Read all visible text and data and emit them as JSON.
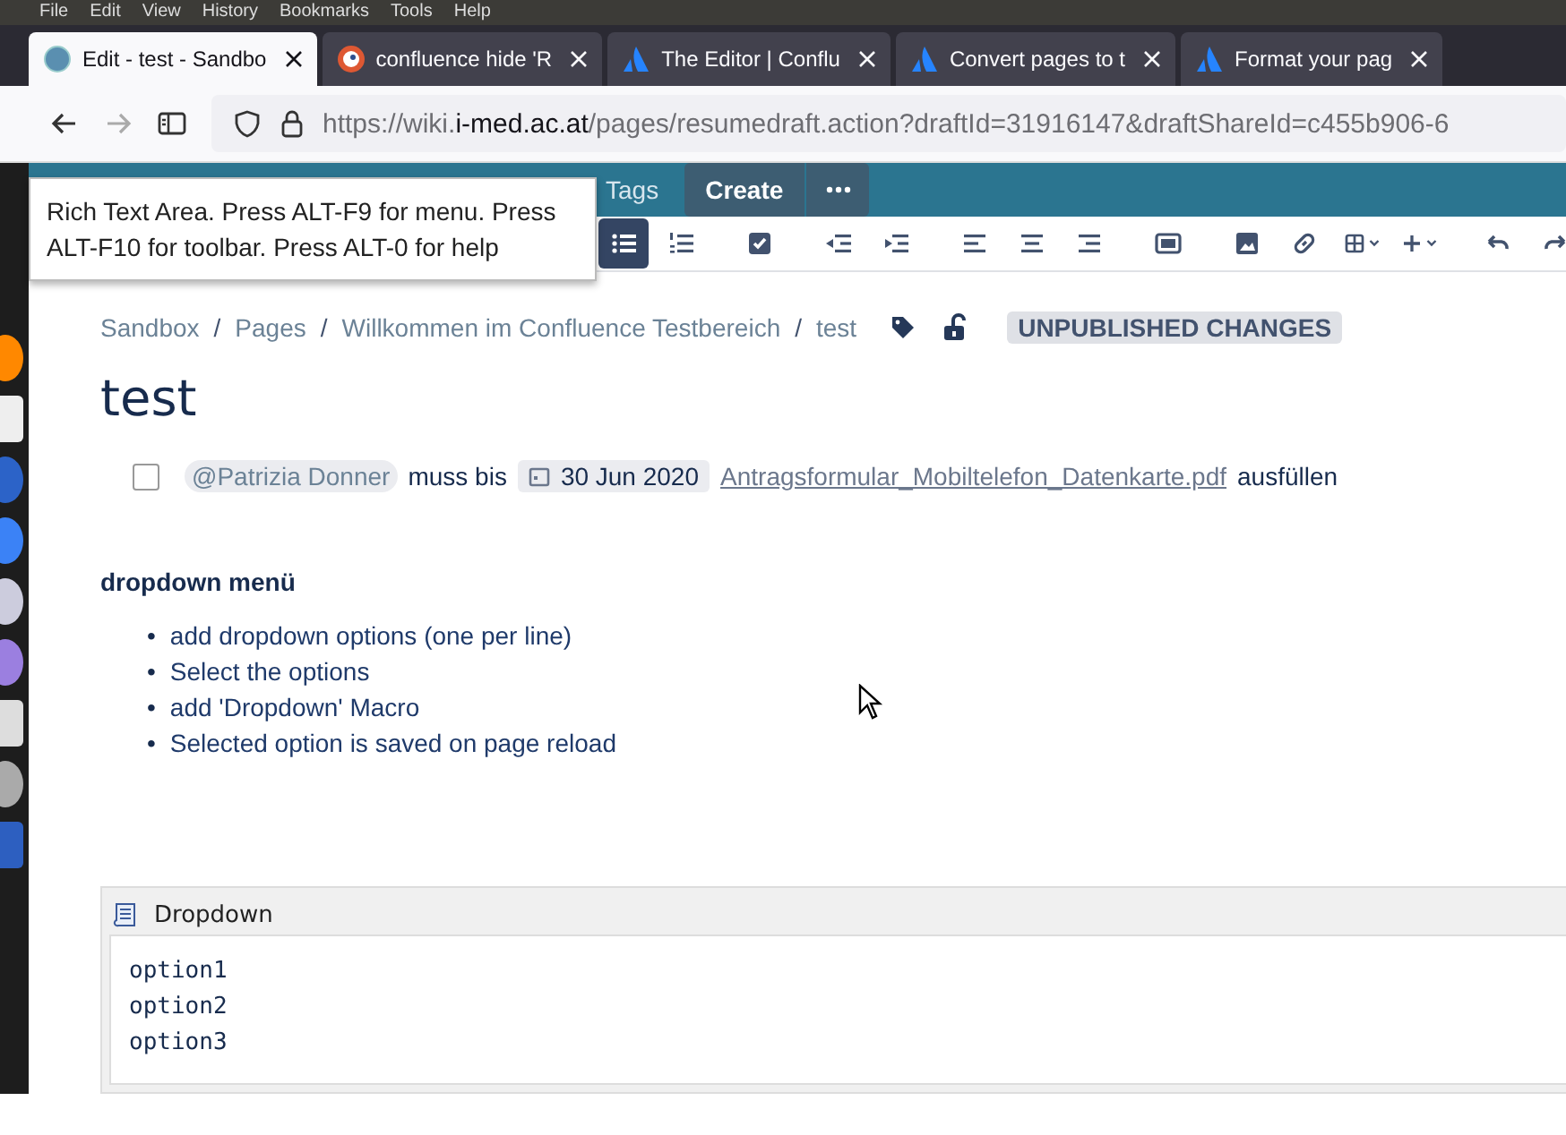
{
  "menu_bar": [
    "File",
    "Edit",
    "View",
    "History",
    "Bookmarks",
    "Tools",
    "Help"
  ],
  "tabs": [
    {
      "label": "Edit - test - Sandbo",
      "kind": "globe",
      "selected": true
    },
    {
      "label": "confluence hide 'R",
      "kind": "duck",
      "selected": false
    },
    {
      "label": "The Editor | Conflu",
      "kind": "atlassian",
      "selected": false
    },
    {
      "label": "Convert pages to t",
      "kind": "atlassian",
      "selected": false
    },
    {
      "label": "Format your pag",
      "kind": "atlassian",
      "selected": false
    }
  ],
  "address": {
    "prefix": "https://wiki.",
    "domain": "i-med.ac.at",
    "path": "/pages/resumedraft.action?draftId=31916147&draftShareId=c455b906-6"
  },
  "header": {
    "tags": "Tags",
    "create": "Create"
  },
  "tooltip": "Rich Text Area. Press ALT-F9 for menu. Press ALT-F10 for toolbar. Press ALT-0 for help",
  "toolbar": [
    {
      "kind": "bullets",
      "selected": true
    },
    {
      "kind": "numbers",
      "selected": false
    },
    {
      "kind": "task",
      "selected": false
    },
    {
      "kind": "outdent",
      "selected": false
    },
    {
      "kind": "indent",
      "selected": false
    },
    {
      "kind": "left",
      "selected": false
    },
    {
      "kind": "center",
      "selected": false
    },
    {
      "kind": "right",
      "selected": false
    },
    {
      "kind": "layout",
      "selected": false
    },
    {
      "kind": "image",
      "selected": false
    },
    {
      "kind": "link",
      "selected": false
    },
    {
      "kind": "table",
      "selected": false
    },
    {
      "kind": "insert",
      "selected": false
    },
    {
      "kind": "undo",
      "selected": false
    },
    {
      "kind": "redo",
      "selected": false
    }
  ],
  "breadcrumbs": [
    "Sandbox",
    "Pages",
    "Willkommen im Confluence Testbereich",
    "test"
  ],
  "breadcrumb_separator": "/",
  "bullet_marker": "•",
  "status_badge": "UNPUBLISHED CHANGES",
  "title": "test",
  "task": {
    "checked": false,
    "mention": "@Patrizia Donner",
    "text_1": "muss bis",
    "date": "30 Jun 2020",
    "attachment": "Antragsformular_Mobiltelefon_Datenkarte.pdf",
    "text_2": "ausfüllen"
  },
  "heading": "dropdown menü",
  "bullets": [
    "add dropdown options (one per line)",
    "Select the options",
    "add 'Dropdown' Macro",
    "Selected option is saved on page reload"
  ],
  "macro": {
    "name": "Dropdown",
    "lines": [
      "option1",
      "option2",
      "option3"
    ]
  }
}
